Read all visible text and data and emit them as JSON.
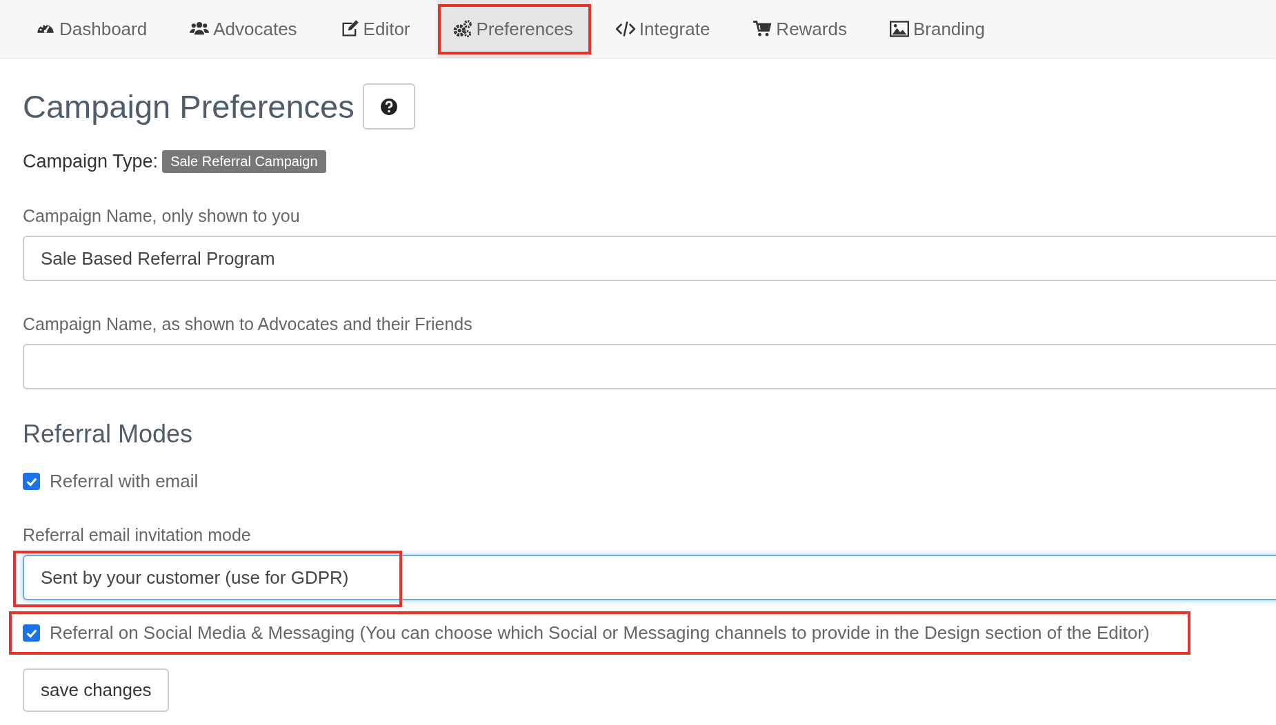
{
  "nav": {
    "tabs": [
      {
        "label": "Dashboard",
        "selected": false,
        "highlighted": false
      },
      {
        "label": "Advocates",
        "selected": false,
        "highlighted": false
      },
      {
        "label": "Editor",
        "selected": false,
        "highlighted": false
      },
      {
        "label": "Preferences",
        "selected": true,
        "highlighted": true
      },
      {
        "label": "Integrate",
        "selected": false,
        "highlighted": false
      },
      {
        "label": "Rewards",
        "selected": false,
        "highlighted": false
      },
      {
        "label": "Branding",
        "selected": false,
        "highlighted": false
      }
    ]
  },
  "page": {
    "title": "Campaign Preferences",
    "campaign_type_label": "Campaign Type:",
    "campaign_type": "Sale Referral Campaign",
    "fields": [
      {
        "label": "Campaign Name, only shown to you",
        "value": "Sale Based Referral Program"
      },
      {
        "label": "Campaign Name, as shown to Advocates and their Friends"
      }
    ],
    "section_title": "Referral Modes",
    "email_mode": {
      "label": "Referral with email",
      "checked": true
    },
    "invitation": {
      "label": "Referral email invitation mode",
      "value": "Sent by your customer (use for GDPR)",
      "focused": true,
      "highlighted": true
    },
    "social_mode": {
      "label": "Referral on Social Media & Messaging (You can choose which Social or Messaging channels to provide in the Design section of the Editor)",
      "checked": true,
      "highlighted": true
    },
    "save_button": "save changes"
  }
}
